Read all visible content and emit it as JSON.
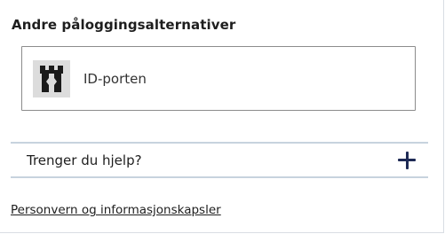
{
  "section": {
    "heading": "Andre påloggingsalternativer"
  },
  "login_options": [
    {
      "label": "ID-porten",
      "icon": "castle-tower-icon"
    }
  ],
  "help": {
    "label": "Trenger du hjelp?",
    "icon": "plus-icon"
  },
  "footer": {
    "privacy_link": "Personvern og informasjonskapsler"
  },
  "colors": {
    "accent_dark": "#1e2a55",
    "divider": "#c7d3de",
    "option_border": "#8c8c8c",
    "logo_bg": "#dcdcdc"
  }
}
